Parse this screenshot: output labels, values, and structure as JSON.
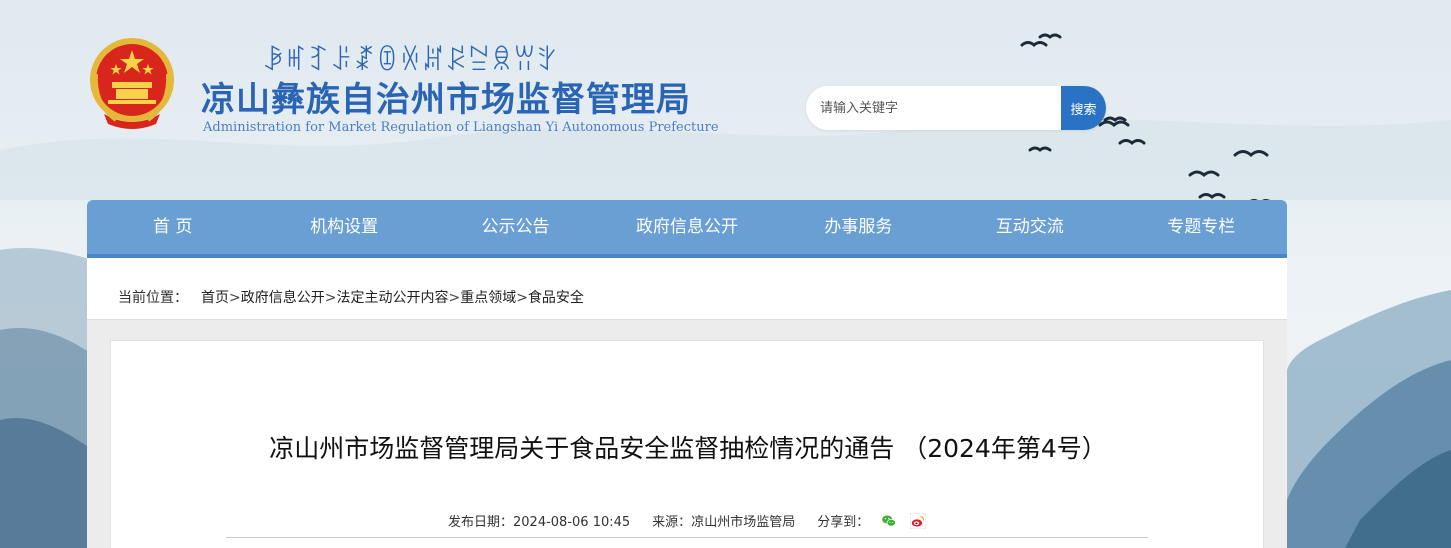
{
  "header": {
    "yi_script": "ꆃꎭꆈꌠꊨꀧꏾꏦꂰꊂꌋꀕꇬ",
    "title": "凉山彝族自治州市场监督管理局",
    "subtitle": "Administration for Market Regulation of Liangshan Yi Autonomous Prefecture"
  },
  "search": {
    "placeholder": "请输入关键字",
    "button_label": "搜索"
  },
  "nav": {
    "items": [
      {
        "label": "首 页"
      },
      {
        "label": "机构设置"
      },
      {
        "label": "公示公告"
      },
      {
        "label": "政府信息公开"
      },
      {
        "label": "办事服务"
      },
      {
        "label": "互动交流"
      },
      {
        "label": "专题专栏"
      }
    ]
  },
  "breadcrumb": {
    "label": "当前位置：",
    "items": [
      "首页",
      "政府信息公开",
      "法定主动公开内容",
      "重点领域",
      "食品安全"
    ],
    "separator": ">"
  },
  "article": {
    "title": "凉山州市场监督管理局关于食品安全监督抽检情况的通告 （2024年第4号）",
    "date_label": "发布日期：",
    "date": "2024-08-06 10:45",
    "source_label": "来源：",
    "source": "凉山州市场监管局",
    "share_label": "分享到："
  },
  "icons": {
    "emblem": "national-emblem-icon",
    "share": [
      "wechat-icon",
      "weibo-icon"
    ]
  },
  "colors": {
    "brand_blue": "#2a64b4",
    "nav_bg": "#6a9fd4",
    "search_button": "#2a73c4"
  }
}
